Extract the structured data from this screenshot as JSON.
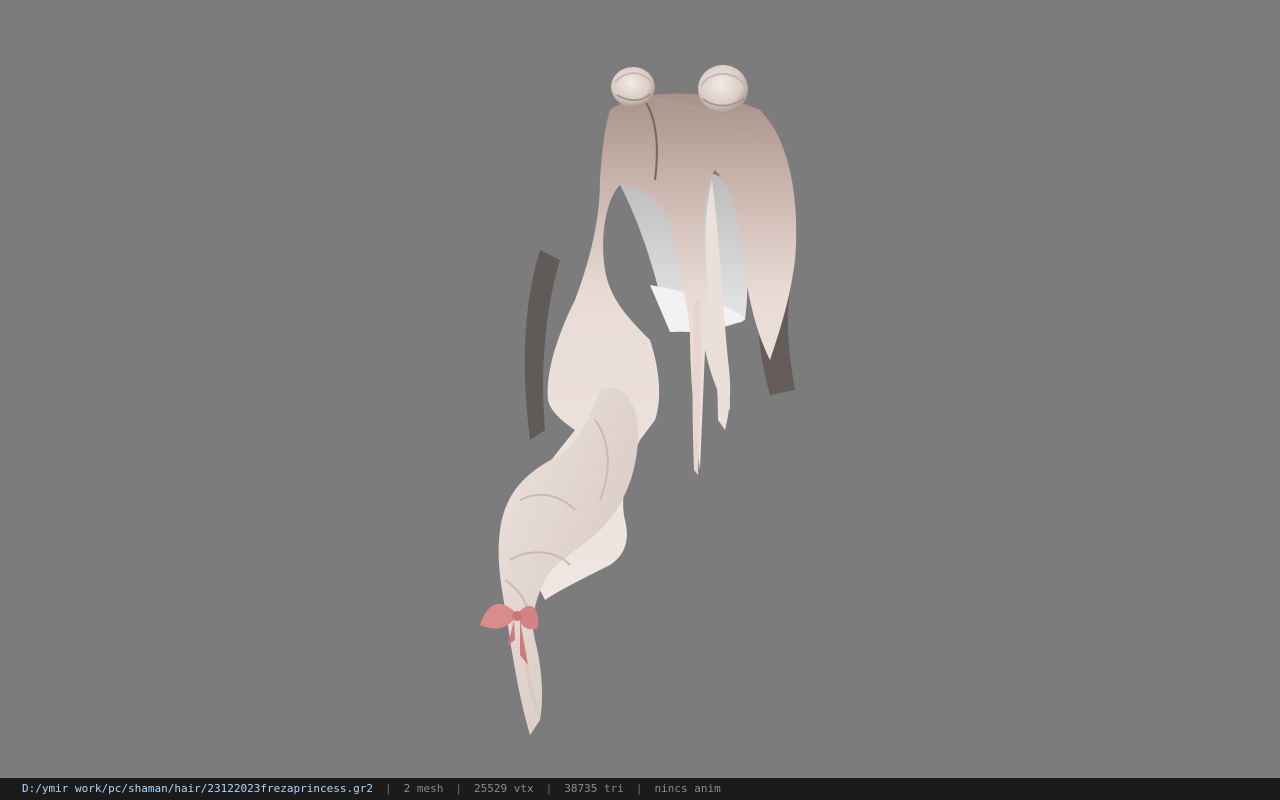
{
  "viewport": {
    "background_color": "#7c7c7c",
    "model": {
      "description_icon": "hair-model-icon",
      "hair_color": "#e8dcd6",
      "root_color": "#8a6f63",
      "ribbon_color": "#d98c8c"
    }
  },
  "status_bar": {
    "file_path": "D:/ymir work/pc/shaman/hair/23122023frezaprincess.gr2",
    "separator": "|",
    "mesh_count": "2 mesh",
    "vertex_count": "25529 vtx",
    "triangle_count": "38735 tri",
    "anim_status": "nincs anim",
    "path_color": "#a8d8ff",
    "background_color": "#1b1b1b"
  }
}
